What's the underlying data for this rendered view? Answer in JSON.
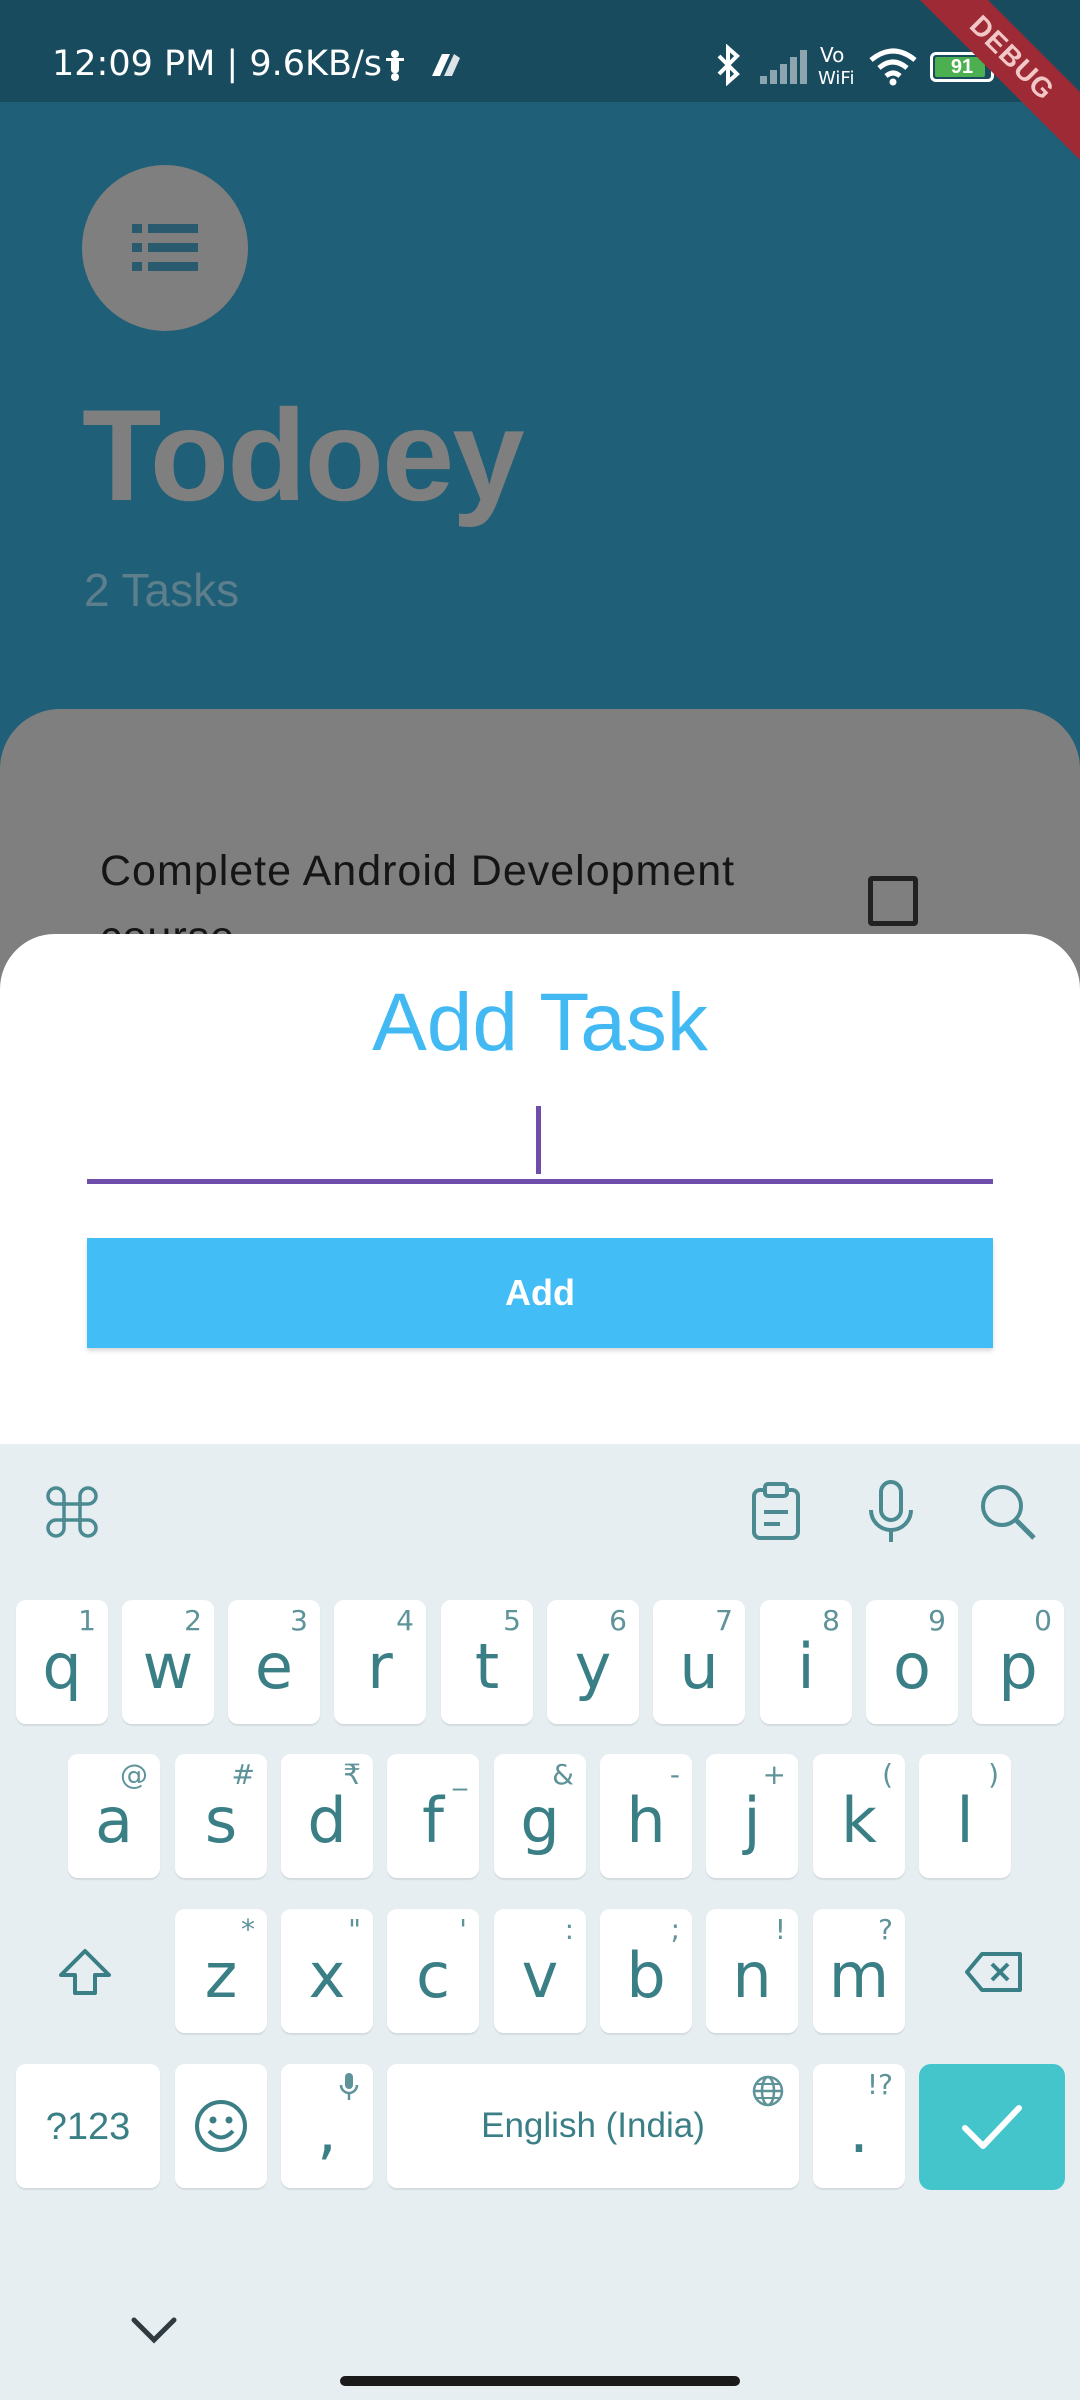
{
  "status_bar": {
    "time": "12:09 PM | 9.6KB/s",
    "battery": "91",
    "debug_banner": "DEBUG"
  },
  "app": {
    "title": "Todoey",
    "task_count": "2 Tasks",
    "tasks": [
      {
        "title": "Complete Android Development course",
        "done": false
      }
    ]
  },
  "sheet": {
    "title": "Add Task",
    "input_value": "",
    "add_label": "Add"
  },
  "keyboard": {
    "row1": [
      {
        "k": "q",
        "h": "1"
      },
      {
        "k": "w",
        "h": "2"
      },
      {
        "k": "e",
        "h": "3"
      },
      {
        "k": "r",
        "h": "4"
      },
      {
        "k": "t",
        "h": "5"
      },
      {
        "k": "y",
        "h": "6"
      },
      {
        "k": "u",
        "h": "7"
      },
      {
        "k": "i",
        "h": "8"
      },
      {
        "k": "o",
        "h": "9"
      },
      {
        "k": "p",
        "h": "0"
      }
    ],
    "row2": [
      {
        "k": "a",
        "h": "@"
      },
      {
        "k": "s",
        "h": "#"
      },
      {
        "k": "d",
        "h": "₹"
      },
      {
        "k": "f",
        "h": "_"
      },
      {
        "k": "g",
        "h": "&"
      },
      {
        "k": "h",
        "h": "-"
      },
      {
        "k": "j",
        "h": "+"
      },
      {
        "k": "k",
        "h": "("
      },
      {
        "k": "l",
        "h": ")"
      }
    ],
    "row3": [
      {
        "k": "z",
        "h": "*"
      },
      {
        "k": "x",
        "h": "\""
      },
      {
        "k": "c",
        "h": "'"
      },
      {
        "k": "v",
        "h": ":"
      },
      {
        "k": "b",
        "h": ";"
      },
      {
        "k": "n",
        "h": "!"
      },
      {
        "k": "m",
        "h": "?"
      }
    ],
    "symbols_label": "?123",
    "comma": ",",
    "space_label": "English (India)",
    "period": ".",
    "period_hint": "!?"
  }
}
